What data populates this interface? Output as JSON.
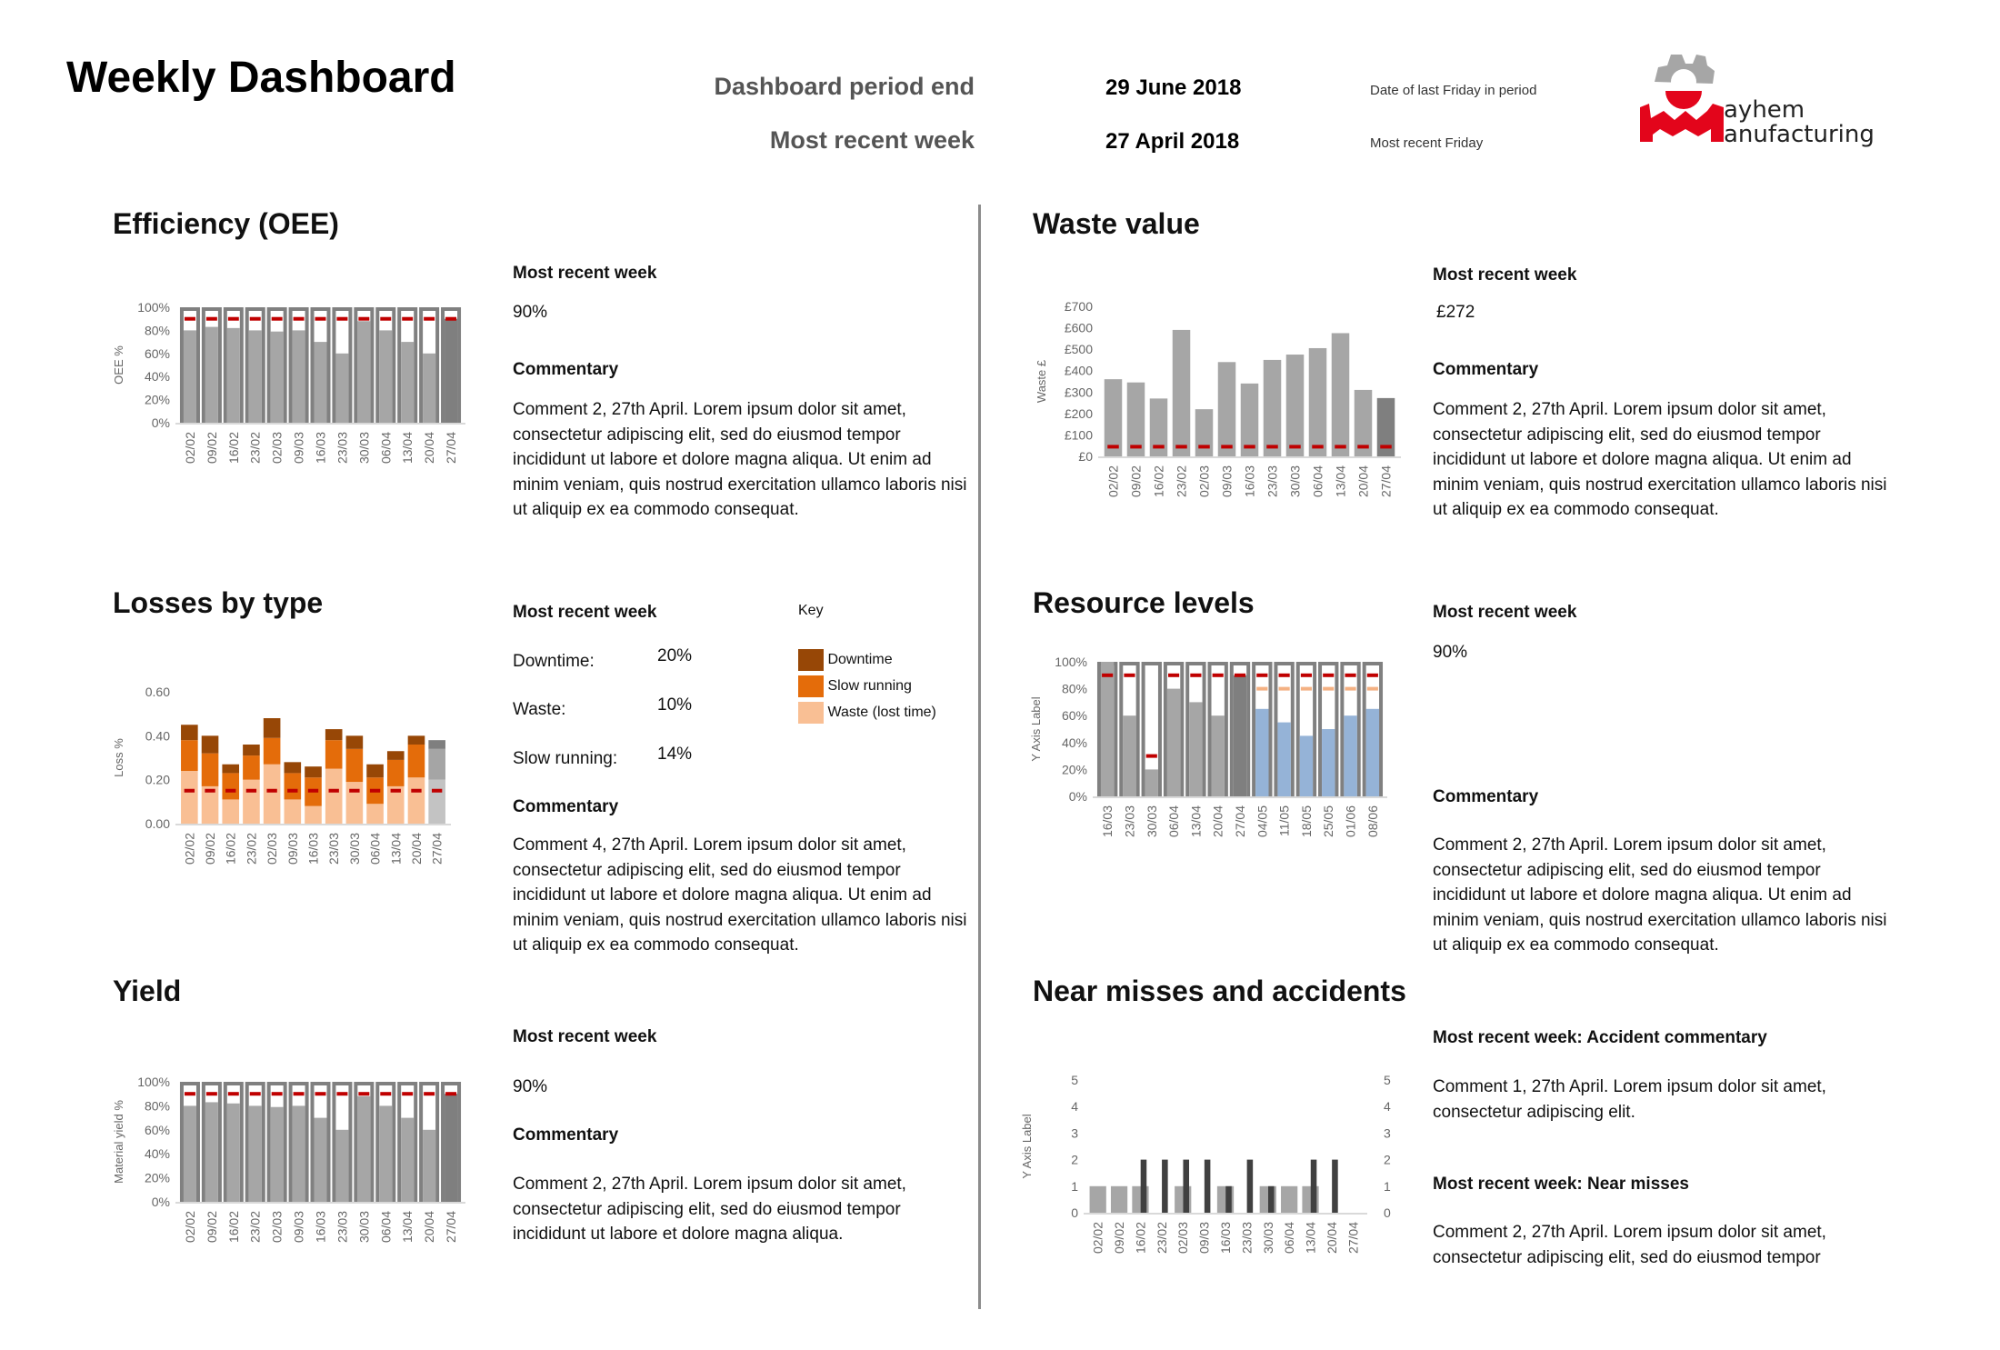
{
  "header": {
    "title": "Weekly Dashboard",
    "period_end_label": "Dashboard period end",
    "period_end_value": "29 June 2018",
    "period_end_note": "Date of last Friday in period",
    "recent_week_label": "Most recent week",
    "recent_week_value": "27 April 2018",
    "recent_week_note": "Most recent Friday",
    "logo_text_line1": "ayhem",
    "logo_text_line2": "anufacturing"
  },
  "colors": {
    "bar": "#a6a6a6",
    "bar_frame": "#808080",
    "highlight": "#7f7f7f",
    "forecast": "#95b3d7",
    "target": "#c00000",
    "target2": "#f4b183",
    "waste_lost": "#f9bf94",
    "slow": "#e46c0a",
    "downtime": "#974706",
    "divider": "#8c8c8c",
    "logo_red": "#e3051b",
    "logo_grey": "#a6a6a6"
  },
  "sections": {
    "oee": {
      "title": "Efficiency (OEE)",
      "recent_label": "Most recent week",
      "recent_value": "90%",
      "commentary_label": "Commentary",
      "comment": "Comment 2,  27th April. Lorem ipsum dolor sit amet, consectetur adipiscing elit, sed do eiusmod tempor incididunt ut labore et dolore magna aliqua. Ut enim ad minim veniam, quis nostrud exercitation ullamco laboris nisi ut aliquip ex ea commodo consequat."
    },
    "waste": {
      "title": "Waste value",
      "recent_label": "Most recent week",
      "recent_value": "£272",
      "commentary_label": "Commentary",
      "comment": "Comment 2,  27th April. Lorem ipsum dolor sit amet, consectetur adipiscing elit, sed do eiusmod tempor incididunt ut labore et dolore magna aliqua. Ut enim ad minim veniam, quis nostrud exercitation ullamco laboris nisi ut aliquip ex ea commodo consequat."
    },
    "losses": {
      "title": "Losses by type",
      "recent_label": "Most recent week",
      "rows": [
        {
          "label": "Downtime:",
          "value": "20%"
        },
        {
          "label": "Waste:",
          "value": "10%"
        },
        {
          "label": "Slow running:",
          "value": "14%"
        }
      ],
      "key_label": "Key",
      "key": [
        {
          "label": "Downtime",
          "color": "#974706"
        },
        {
          "label": "Slow running",
          "color": "#e46c0a"
        },
        {
          "label": "Waste (lost time)",
          "color": "#f9bf94"
        }
      ],
      "commentary_label": "Commentary",
      "comment": "Comment 4,  27th April. Lorem ipsum dolor sit amet, consectetur adipiscing elit, sed do eiusmod tempor incididunt ut labore et dolore magna aliqua. Ut enim ad minim veniam, quis nostrud exercitation ullamco laboris nisi ut aliquip ex ea commodo consequat."
    },
    "resource": {
      "title": "Resource levels",
      "recent_label": "Most recent week",
      "recent_value": "90%",
      "commentary_label": "Commentary",
      "comment": "Comment 2,  27th April. Lorem ipsum dolor sit amet, consectetur adipiscing elit, sed do eiusmod tempor incididunt ut labore et dolore magna aliqua. Ut enim ad minim veniam, quis nostrud exercitation ullamco laboris nisi ut aliquip ex ea commodo consequat."
    },
    "yield": {
      "title": "Yield",
      "recent_label": "Most recent week",
      "recent_value": "90%",
      "commentary_label": "Commentary",
      "comment": "Comment 2,  27th April. Lorem ipsum dolor sit amet, consectetur adipiscing elit, sed do eiusmod tempor incididunt ut labore et dolore magna aliqua."
    },
    "near": {
      "title": "Near misses and accidents",
      "accident_label": "Most recent week: Accident commentary",
      "accident_comment": "Comment 1, 27th April. Lorem ipsum dolor sit amet, consectetur adipiscing elit.",
      "near_label": "Most recent week: Near misses",
      "near_comment": "Comment 2,  27th April. Lorem ipsum dolor sit amet, consectetur adipiscing elit, sed do eiusmod tempor"
    }
  },
  "chart_data": [
    {
      "id": "oee",
      "type": "bar",
      "stacked_to": 100,
      "ylabel": "OEE %",
      "ylim": [
        0,
        100
      ],
      "yticks": [
        "0%",
        "20%",
        "40%",
        "60%",
        "80%",
        "100%"
      ],
      "categories": [
        "02/02",
        "09/02",
        "16/02",
        "23/02",
        "02/03",
        "09/03",
        "16/03",
        "23/03",
        "30/03",
        "06/04",
        "13/04",
        "20/04",
        "27/04"
      ],
      "values": [
        80,
        83,
        82,
        80,
        79,
        80,
        70,
        60,
        88,
        80,
        70,
        60,
        90
      ],
      "target": [
        90,
        90,
        90,
        90,
        90,
        90,
        90,
        90,
        90,
        90,
        90,
        90,
        90
      ],
      "highlight_last": true
    },
    {
      "id": "waste",
      "type": "bar",
      "ylabel": "Waste £",
      "ylim": [
        0,
        700
      ],
      "yticks": [
        "£0",
        "£100",
        "£200",
        "£300",
        "£400",
        "£500",
        "£600",
        "£700"
      ],
      "categories": [
        "02/02",
        "09/02",
        "16/02",
        "23/02",
        "02/03",
        "09/03",
        "16/03",
        "23/03",
        "30/03",
        "06/04",
        "13/04",
        "20/04",
        "27/04"
      ],
      "values": [
        360,
        345,
        270,
        590,
        220,
        440,
        340,
        450,
        475,
        505,
        575,
        310,
        272
      ],
      "target": [
        45,
        45,
        45,
        45,
        45,
        45,
        45,
        45,
        45,
        45,
        45,
        45,
        45
      ],
      "highlight_last": true
    },
    {
      "id": "losses",
      "type": "bar",
      "stacked": true,
      "ylabel": "Loss %",
      "ylim": [
        0,
        0.6
      ],
      "yticks": [
        "0.00",
        "0.20",
        "0.40",
        "0.60"
      ],
      "categories": [
        "02/02",
        "09/02",
        "16/02",
        "23/02",
        "02/03",
        "09/03",
        "16/03",
        "23/03",
        "30/03",
        "06/04",
        "13/04",
        "20/04",
        "27/04"
      ],
      "series": [
        {
          "name": "Waste (lost time)",
          "values": [
            0.24,
            0.17,
            0.11,
            0.2,
            0.27,
            0.11,
            0.08,
            0.25,
            0.19,
            0.09,
            0.17,
            0.21,
            0.2
          ]
        },
        {
          "name": "Slow running",
          "values": [
            0.14,
            0.15,
            0.12,
            0.11,
            0.12,
            0.12,
            0.13,
            0.13,
            0.15,
            0.12,
            0.12,
            0.15,
            0.14
          ]
        },
        {
          "name": "Downtime",
          "values": [
            0.07,
            0.08,
            0.04,
            0.05,
            0.09,
            0.05,
            0.05,
            0.05,
            0.06,
            0.06,
            0.04,
            0.04,
            0.04
          ]
        }
      ],
      "target": [
        0.15,
        0.15,
        0.15,
        0.15,
        0.15,
        0.15,
        0.15,
        0.15,
        0.15,
        0.15,
        0.15,
        0.15,
        0.15
      ],
      "highlight_last": true
    },
    {
      "id": "resource",
      "type": "bar",
      "stacked_to": 100,
      "ylabel": "Y Axis Label",
      "ylim": [
        0,
        100
      ],
      "yticks": [
        "0%",
        "20%",
        "40%",
        "60%",
        "80%",
        "100%"
      ],
      "categories": [
        "16/03",
        "23/03",
        "30/03",
        "06/04",
        "13/04",
        "20/04",
        "27/04",
        "04/05",
        "11/05",
        "18/05",
        "25/05",
        "01/06",
        "08/06"
      ],
      "values": [
        100,
        60,
        20,
        80,
        70,
        60,
        90,
        65,
        55,
        45,
        50,
        60,
        65
      ],
      "target": [
        90,
        90,
        30,
        90,
        90,
        90,
        90,
        90,
        90,
        90,
        90,
        90,
        90
      ],
      "target2": [
        null,
        null,
        null,
        null,
        null,
        null,
        null,
        80,
        80,
        80,
        80,
        80,
        80
      ],
      "highlight_index": 6,
      "forecast_from": 7
    },
    {
      "id": "yield",
      "type": "bar",
      "stacked_to": 100,
      "ylabel": "Material yield %",
      "ylim": [
        0,
        100
      ],
      "yticks": [
        "0%",
        "20%",
        "40%",
        "60%",
        "80%",
        "100%"
      ],
      "categories": [
        "02/02",
        "09/02",
        "16/02",
        "23/02",
        "02/03",
        "09/03",
        "16/03",
        "23/03",
        "30/03",
        "06/04",
        "13/04",
        "20/04",
        "27/04"
      ],
      "values": [
        80,
        83,
        82,
        80,
        79,
        80,
        70,
        60,
        88,
        80,
        70,
        60,
        90
      ],
      "target": [
        90,
        90,
        90,
        90,
        90,
        90,
        90,
        90,
        90,
        90,
        90,
        90,
        90
      ],
      "highlight_last": true
    },
    {
      "id": "near",
      "type": "bar",
      "ylabel": "Y Axis Label",
      "ylim": [
        0,
        5
      ],
      "yticks": [
        "0",
        "1",
        "2",
        "3",
        "4",
        "5"
      ],
      "secondary_axis": true,
      "categories": [
        "02/02",
        "09/02",
        "16/02",
        "23/02",
        "02/03",
        "09/03",
        "16/03",
        "23/03",
        "30/03",
        "06/04",
        "13/04",
        "20/04",
        "27/04"
      ],
      "series": [
        {
          "values": [
            1,
            1,
            1,
            0,
            1,
            0,
            1,
            0,
            1,
            1,
            1,
            0,
            0
          ]
        },
        {
          "values": [
            0,
            0,
            2,
            2,
            2,
            2,
            1,
            2,
            1,
            0,
            2,
            2,
            0
          ]
        }
      ]
    }
  ]
}
